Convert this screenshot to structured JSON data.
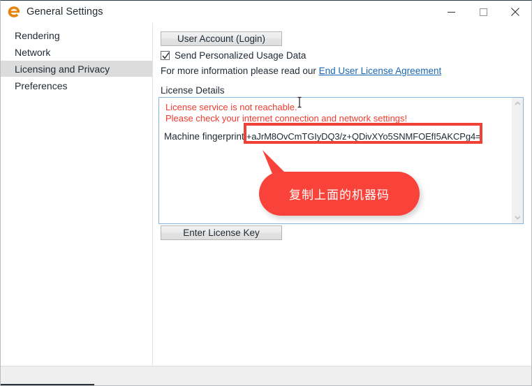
{
  "window": {
    "title": "General Settings",
    "logo_icon": "enscape-e-logo",
    "controls": [
      {
        "name": "minimize",
        "icon": "minimize-icon"
      },
      {
        "name": "maximize",
        "icon": "maximize-icon"
      },
      {
        "name": "close",
        "icon": "close-icon"
      }
    ],
    "accent_color": "#e8820c"
  },
  "sidebar": {
    "items": [
      {
        "label": "Rendering",
        "selected": false
      },
      {
        "label": "Network",
        "selected": false
      },
      {
        "label": "Licensing and Privacy",
        "selected": true
      },
      {
        "label": "Preferences",
        "selected": false
      }
    ],
    "selected_background": "#dcdcdc"
  },
  "panel": {
    "user_account_button": "User Account (Login)",
    "usage_data_checkbox": {
      "label": "Send Personalized Usage Data",
      "checked": true
    },
    "info_text_prefix": "For more information please read our ",
    "eula_link": "End User License Agreement",
    "eula_link_color": "#1966b0",
    "section_label": "License Details",
    "license_details": {
      "error_line_1": "License service is not reachable.",
      "error_line_2": "Please check your internet connection and network settings!",
      "error_color": "#f03a2e",
      "fingerprint_label": "Machine fingerprint",
      "fingerprint_value": "+aJrM8OvCmTGIyDQ3/z+QDivXYo5SNMFOEfI5AKCPg4=",
      "border_color": "#85b4e3",
      "scrollbar": {
        "up_arrow_icon": "chevron-up-icon",
        "down_arrow_icon": "chevron-down-icon"
      }
    },
    "enter_license_button": "Enter License Key"
  },
  "annotation": {
    "highlight_box_color": "#ef4135",
    "callout_text": "复制上面的机器码",
    "callout_background": "#f9423a",
    "callout_text_color": "#ffffff"
  },
  "cursor": {
    "type": "i-beam-text-cursor"
  }
}
